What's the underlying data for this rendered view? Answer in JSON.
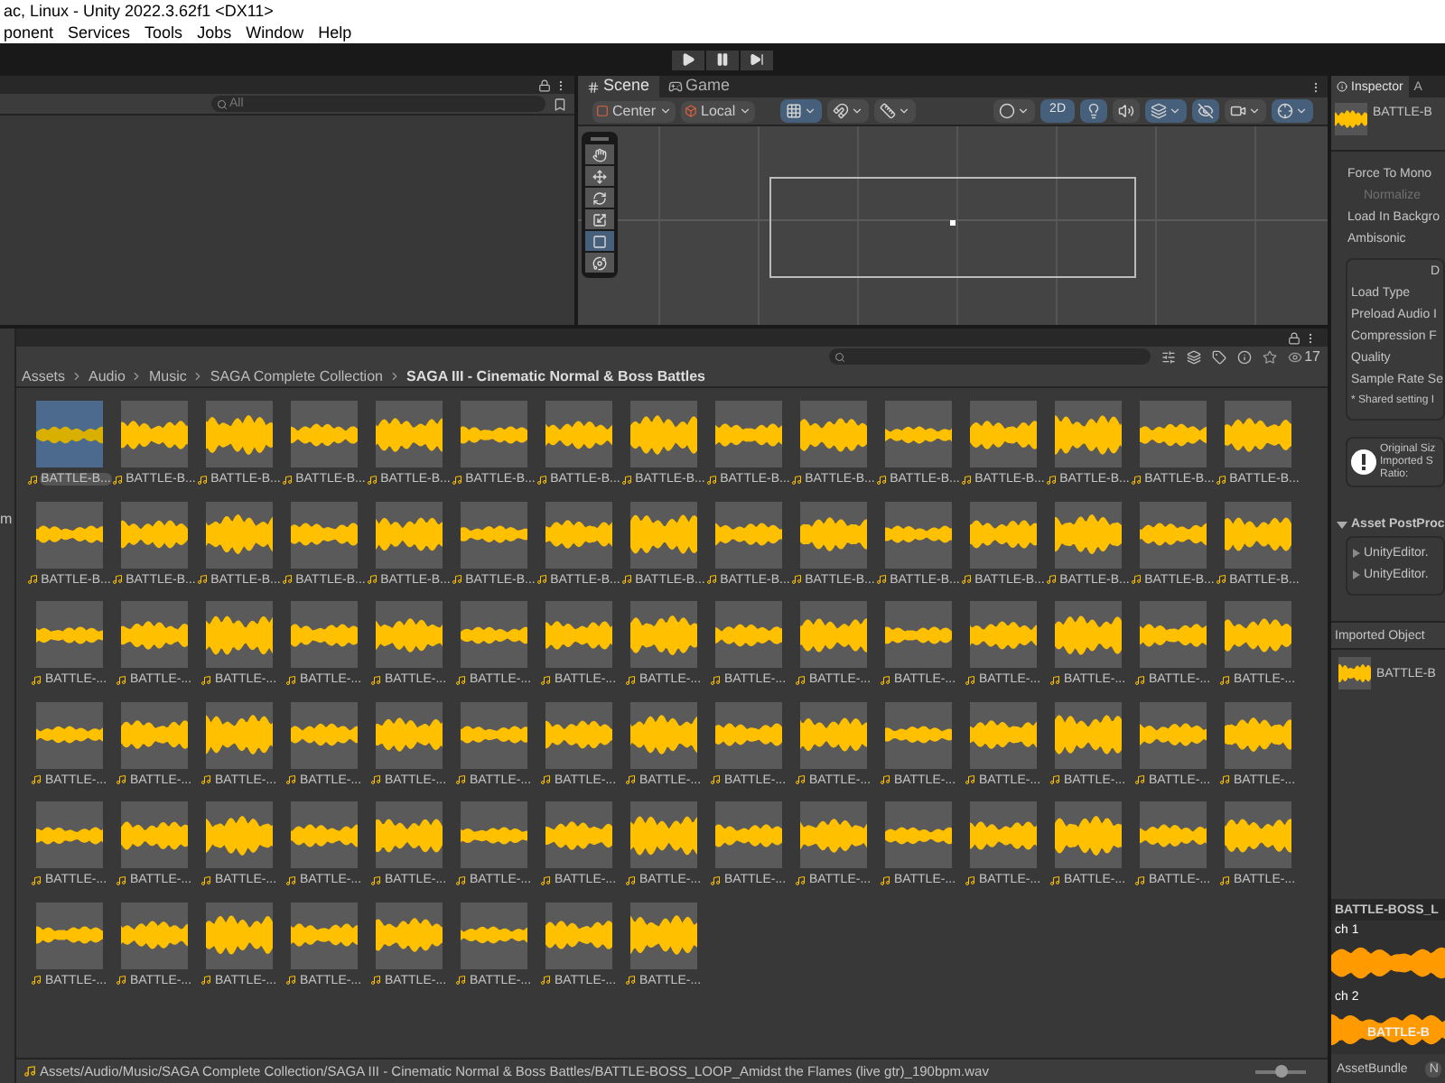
{
  "window": {
    "title": "ac, Linux - Unity 2022.3.62f1 <DX11>"
  },
  "menu": [
    "ponent",
    "Services",
    "Tools",
    "Jobs",
    "Window",
    "Help"
  ],
  "hierarchy": {
    "search": {
      "placeholder": "All"
    }
  },
  "scene_view": {
    "tabs": [
      {
        "label": "Scene",
        "selected": true
      },
      {
        "label": "Game",
        "selected": false
      }
    ],
    "pivot": "Center",
    "space": "Local",
    "mode_2d": {
      "label": "2D",
      "on": true
    },
    "tools": [
      {
        "kind": "hand",
        "selected": false
      },
      {
        "kind": "move",
        "selected": false
      },
      {
        "kind": "rotate",
        "selected": false
      },
      {
        "kind": "scale",
        "selected": false
      },
      {
        "kind": "rect",
        "selected": true
      },
      {
        "kind": "transform",
        "selected": false
      }
    ]
  },
  "project": {
    "sidebar_fragment": "m",
    "search_count": "17",
    "breadcrumb": [
      {
        "label": "Assets",
        "current": false
      },
      {
        "label": "Audio",
        "current": false
      },
      {
        "label": "Music",
        "current": false
      },
      {
        "label": "SAGA Complete Collection",
        "current": false
      },
      {
        "label": "SAGA III - Cinematic Normal & Boss Battles",
        "current": true
      }
    ],
    "assets": [
      {
        "label": "BATTLE-B...",
        "selected": true
      },
      {
        "label": "BATTLE-B...",
        "selected": false
      },
      {
        "label": "BATTLE-B...",
        "selected": false
      },
      {
        "label": "BATTLE-B...",
        "selected": false
      },
      {
        "label": "BATTLE-B...",
        "selected": false
      },
      {
        "label": "BATTLE-B...",
        "selected": false
      },
      {
        "label": "BATTLE-B...",
        "selected": false
      },
      {
        "label": "BATTLE-B...",
        "selected": false
      },
      {
        "label": "BATTLE-B...",
        "selected": false
      },
      {
        "label": "BATTLE-B...",
        "selected": false
      },
      {
        "label": "BATTLE-B...",
        "selected": false
      },
      {
        "label": "BATTLE-B...",
        "selected": false
      },
      {
        "label": "BATTLE-B...",
        "selected": false
      },
      {
        "label": "BATTLE-B...",
        "selected": false
      },
      {
        "label": "BATTLE-B...",
        "selected": false
      },
      {
        "label": "BATTLE-B...",
        "selected": false
      },
      {
        "label": "BATTLE-B...",
        "selected": false
      },
      {
        "label": "BATTLE-B...",
        "selected": false
      },
      {
        "label": "BATTLE-B...",
        "selected": false
      },
      {
        "label": "BATTLE-B...",
        "selected": false
      },
      {
        "label": "BATTLE-B...",
        "selected": false
      },
      {
        "label": "BATTLE-B...",
        "selected": false
      },
      {
        "label": "BATTLE-B...",
        "selected": false
      },
      {
        "label": "BATTLE-B...",
        "selected": false
      },
      {
        "label": "BATTLE-B...",
        "selected": false
      },
      {
        "label": "BATTLE-B...",
        "selected": false
      },
      {
        "label": "BATTLE-B...",
        "selected": false
      },
      {
        "label": "BATTLE-B...",
        "selected": false
      },
      {
        "label": "BATTLE-B...",
        "selected": false
      },
      {
        "label": "BATTLE-B...",
        "selected": false
      },
      {
        "label": "BATTLE-...",
        "selected": false
      },
      {
        "label": "BATTLE-...",
        "selected": false
      },
      {
        "label": "BATTLE-...",
        "selected": false
      },
      {
        "label": "BATTLE-...",
        "selected": false
      },
      {
        "label": "BATTLE-...",
        "selected": false
      },
      {
        "label": "BATTLE-...",
        "selected": false
      },
      {
        "label": "BATTLE-...",
        "selected": false
      },
      {
        "label": "BATTLE-...",
        "selected": false
      },
      {
        "label": "BATTLE-...",
        "selected": false
      },
      {
        "label": "BATTLE-...",
        "selected": false
      },
      {
        "label": "BATTLE-...",
        "selected": false
      },
      {
        "label": "BATTLE-...",
        "selected": false
      },
      {
        "label": "BATTLE-...",
        "selected": false
      },
      {
        "label": "BATTLE-...",
        "selected": false
      },
      {
        "label": "BATTLE-...",
        "selected": false
      },
      {
        "label": "BATTLE-...",
        "selected": false
      },
      {
        "label": "BATTLE-...",
        "selected": false
      },
      {
        "label": "BATTLE-...",
        "selected": false
      },
      {
        "label": "BATTLE-...",
        "selected": false
      },
      {
        "label": "BATTLE-...",
        "selected": false
      },
      {
        "label": "BATTLE-...",
        "selected": false
      },
      {
        "label": "BATTLE-...",
        "selected": false
      },
      {
        "label": "BATTLE-...",
        "selected": false
      },
      {
        "label": "BATTLE-...",
        "selected": false
      },
      {
        "label": "BATTLE-...",
        "selected": false
      },
      {
        "label": "BATTLE-...",
        "selected": false
      },
      {
        "label": "BATTLE-...",
        "selected": false
      },
      {
        "label": "BATTLE-...",
        "selected": false
      },
      {
        "label": "BATTLE-...",
        "selected": false
      },
      {
        "label": "BATTLE-...",
        "selected": false
      },
      {
        "label": "BATTLE-...",
        "selected": false
      },
      {
        "label": "BATTLE-...",
        "selected": false
      },
      {
        "label": "BATTLE-...",
        "selected": false
      },
      {
        "label": "BATTLE-...",
        "selected": false
      },
      {
        "label": "BATTLE-...",
        "selected": false
      },
      {
        "label": "BATTLE-...",
        "selected": false
      },
      {
        "label": "BATTLE-...",
        "selected": false
      },
      {
        "label": "BATTLE-...",
        "selected": false
      },
      {
        "label": "BATTLE-...",
        "selected": false
      },
      {
        "label": "BATTLE-...",
        "selected": false
      },
      {
        "label": "BATTLE-...",
        "selected": false
      },
      {
        "label": "BATTLE-...",
        "selected": false
      },
      {
        "label": "BATTLE-...",
        "selected": false
      },
      {
        "label": "BATTLE-...",
        "selected": false
      },
      {
        "label": "BATTLE-...",
        "selected": false
      },
      {
        "label": "BATTLE-...",
        "selected": false
      },
      {
        "label": "BATTLE-...",
        "selected": false
      },
      {
        "label": "BATTLE-...",
        "selected": false
      },
      {
        "label": "BATTLE-...",
        "selected": false
      },
      {
        "label": "BATTLE-...",
        "selected": false
      },
      {
        "label": "BATTLE-...",
        "selected": false
      },
      {
        "label": "BATTLE-...",
        "selected": false
      },
      {
        "label": "BATTLE-...",
        "selected": false
      }
    ],
    "status_path": "Assets/Audio/Music/SAGA Complete Collection/SAGA III - Cinematic Normal & Boss Battles/BATTLE-BOSS_LOOP_Amidst the Flames (live gtr)_190bpm.wav",
    "zoom": {
      "level": 0.5
    }
  },
  "inspector": {
    "tabs": [
      {
        "label": "Inspector",
        "selected": true
      },
      {
        "label": "A",
        "selected": false
      }
    ],
    "asset_name": "BATTLE-B",
    "options": [
      {
        "label": "Force To Mono",
        "disabled": false
      },
      {
        "label": "Normalize",
        "disabled": true
      },
      {
        "label": "Load In Backgro",
        "disabled": false
      },
      {
        "label": "Ambisonic",
        "disabled": false
      }
    ],
    "settings_box": {
      "header": "D",
      "rows": [
        "Load Type",
        "Preload Audio I",
        "Compression F",
        "Quality",
        "Sample Rate Se"
      ],
      "note": "* Shared setting I"
    },
    "info": [
      "Original Siz",
      "Imported S",
      "Ratio:"
    ],
    "postprocessors": {
      "title": "Asset PostProc",
      "expanded": true,
      "items": [
        "UnityEditor.",
        "UnityEditor."
      ]
    },
    "imported_object": {
      "title": "Imported Object",
      "name": "BATTLE-B"
    },
    "preview": {
      "title": "BATTLE-BOSS_L",
      "channels": [
        "ch 1",
        "ch 2"
      ],
      "overlay": "BATTLE-B"
    },
    "asset_bundle": {
      "label": "AssetBundle",
      "value": "N"
    }
  }
}
